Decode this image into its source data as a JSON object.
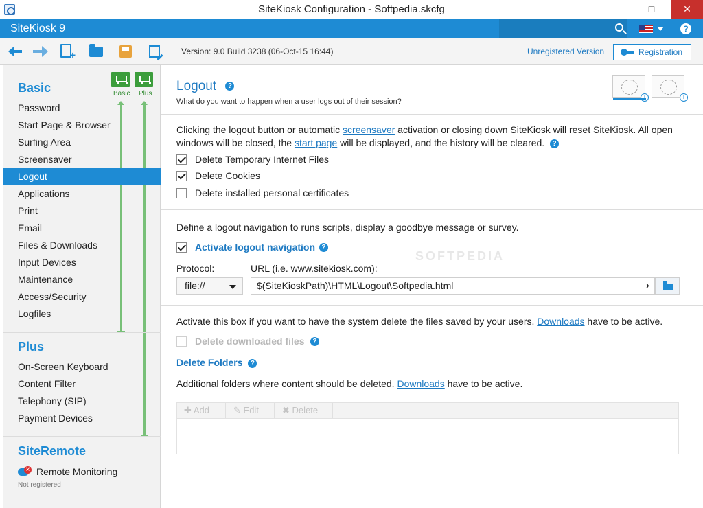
{
  "window": {
    "title": "SiteKiosk Configuration - Softpedia.skcfg",
    "minimize": "–",
    "maximize": "□",
    "close": "✕"
  },
  "header": {
    "brand": "SiteKiosk 9",
    "help": "?"
  },
  "toolbar": {
    "version": "Version: 9.0 Build 3238 (06-Oct-15 16:44)",
    "unregistered": "Unregistered Version",
    "registration": "Registration"
  },
  "sidebar": {
    "basic_title": "Basic",
    "basic_cart_label": "Basic",
    "plus_cart_label": "Plus",
    "basic_items": [
      "Password",
      "Start Page & Browser",
      "Surfing Area",
      "Screensaver",
      "Logout",
      "Applications",
      "Print",
      "Email",
      "Files & Downloads",
      "Input Devices",
      "Maintenance",
      "Access/Security",
      "Logfiles"
    ],
    "plus_title": "Plus",
    "plus_items": [
      "On-Screen Keyboard",
      "Content Filter",
      "Telephony (SIP)",
      "Payment Devices"
    ],
    "siteremote_title": "SiteRemote",
    "remote_monitoring": "Remote Monitoring",
    "not_registered": "Not registered"
  },
  "main": {
    "title": "Logout",
    "subtitle": "What do you want to happen when a user logs out of their session?",
    "section1": {
      "text_a": "Clicking the logout button or automatic ",
      "link_screensaver": "screensaver",
      "text_b": " activation or closing down SiteKiosk will reset SiteKiosk. All open",
      "text_c": "windows will be closed, the ",
      "link_startpage": "start page",
      "text_d": " will be displayed, and the history will be cleared.",
      "checkboxes": [
        {
          "label": "Delete Temporary Internet Files",
          "checked": true
        },
        {
          "label": "Delete Cookies",
          "checked": true
        },
        {
          "label": "Delete installed personal certificates",
          "checked": false
        }
      ]
    },
    "section2": {
      "text": "Define a logout navigation to runs scripts, display a goodbye message or survey.",
      "activate_label": "Activate logout navigation",
      "protocol_label": "Protocol:",
      "url_label": "URL (i.e. www.sitekiosk.com):",
      "protocol_value": "file://",
      "url_value": "$(SiteKioskPath)\\HTML\\Logout\\Softpedia.html"
    },
    "section3": {
      "text_a": "Activate this box if you want to have the system delete the files saved by your users. ",
      "link_downloads": "Downloads",
      "text_b": " have to be active.",
      "delete_downloaded": "Delete downloaded files",
      "delete_folders_title": "Delete Folders",
      "folders_text_a": "Additional folders where content should be deleted. ",
      "folders_text_b": " have to be active.",
      "grid_buttons": [
        "Add",
        "Edit",
        "Delete"
      ]
    },
    "watermark": "SOFTPEDIA"
  },
  "colors": {
    "accent": "#1e8bd4",
    "active_nav": "#1e8bd4",
    "cart_green": "#3c9d3c",
    "close_red": "#c7302c"
  }
}
